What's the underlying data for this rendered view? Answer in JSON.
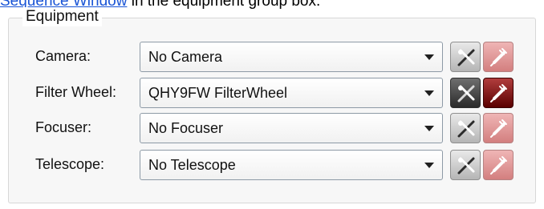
{
  "intro": {
    "link_text": "Sequence Window",
    "rest_text": " in the equipment group box."
  },
  "equipment": {
    "title": "Equipment",
    "rows": [
      {
        "label": "Camera:",
        "value": "No Camera",
        "setup_icon": "tools-icon",
        "connect_icon": "plug-icon",
        "connected_device": false
      },
      {
        "label": "Filter Wheel:",
        "value": "QHY9FW FilterWheel",
        "setup_icon": "tools-icon",
        "connect_icon": "plug-icon",
        "connected_device": true
      },
      {
        "label": "Focuser:",
        "value": "No Focuser",
        "setup_icon": "tools-icon",
        "connect_icon": "plug-icon",
        "connected_device": false
      },
      {
        "label": "Telescope:",
        "value": "No Telescope",
        "setup_icon": "tools-icon",
        "connect_icon": "plug-icon",
        "connected_device": false
      }
    ]
  }
}
